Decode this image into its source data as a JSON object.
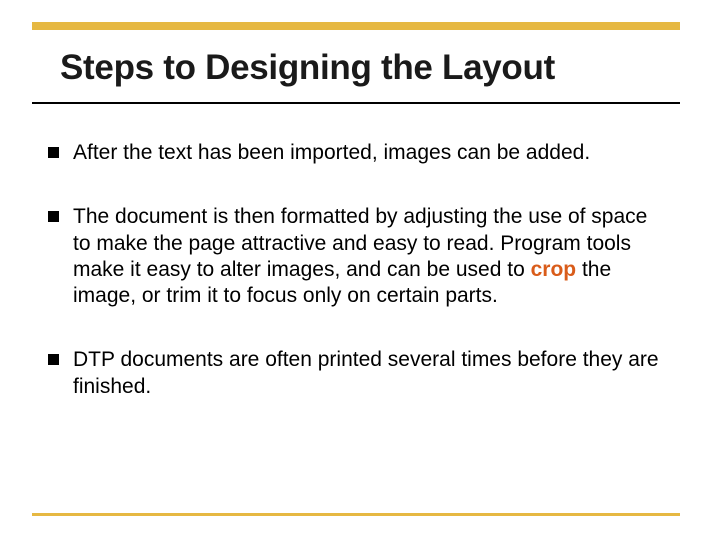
{
  "title": "Steps to Designing the Layout",
  "bullets": [
    {
      "pre": "After the text has been imported, images can be added.",
      "bold": "",
      "post": ""
    },
    {
      "pre": "The document is then formatted by adjusting the use of space to make the page attractive and easy to read. Program tools make it easy to alter images, and can be used to ",
      "bold": "crop",
      "post": " the image, or trim it to focus only on certain parts."
    },
    {
      "pre": "DTP documents are often printed several times before they are finished.",
      "bold": "",
      "post": ""
    }
  ],
  "colors": {
    "accent_bar": "#e6b842",
    "bold_text": "#d95c1a"
  }
}
